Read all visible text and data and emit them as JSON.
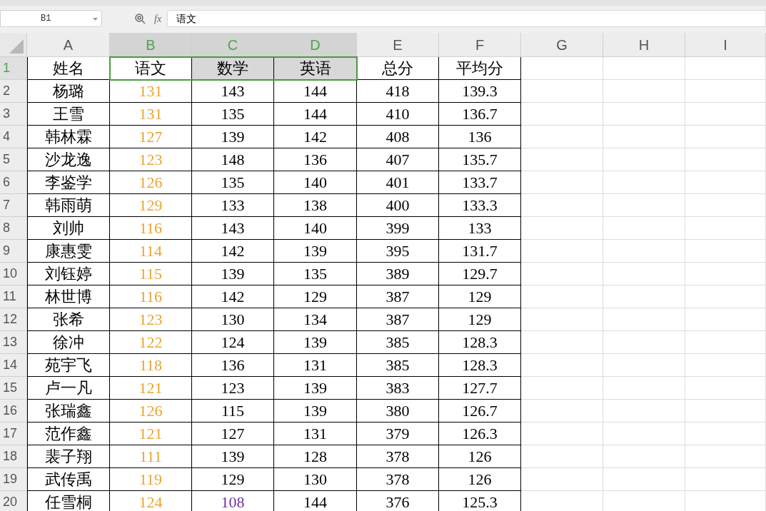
{
  "formula_bar": {
    "name_box": "B1",
    "fx_label": "fx",
    "formula": "语文"
  },
  "columns": [
    {
      "label": "A",
      "selected": false
    },
    {
      "label": "B",
      "selected": true
    },
    {
      "label": "C",
      "selected": true
    },
    {
      "label": "D",
      "selected": true
    },
    {
      "label": "E",
      "selected": false
    },
    {
      "label": "F",
      "selected": false
    },
    {
      "label": "G",
      "selected": false
    },
    {
      "label": "H",
      "selected": false
    },
    {
      "label": "I",
      "selected": false
    }
  ],
  "rows": [
    {
      "number": "1",
      "selected": true,
      "cells": [
        {
          "text": "姓名"
        },
        {
          "text": "语文"
        },
        {
          "text": "数学"
        },
        {
          "text": "英语"
        },
        {
          "text": "总分"
        },
        {
          "text": "平均分"
        }
      ]
    },
    {
      "number": "2",
      "selected": false,
      "cells": [
        {
          "text": "杨璐"
        },
        {
          "text": "131",
          "color": "#eaa42f"
        },
        {
          "text": "143"
        },
        {
          "text": "144"
        },
        {
          "text": "418"
        },
        {
          "text": "139.3"
        }
      ]
    },
    {
      "number": "3",
      "selected": false,
      "cells": [
        {
          "text": "王雪"
        },
        {
          "text": "131",
          "color": "#eaa42f"
        },
        {
          "text": "135"
        },
        {
          "text": "144"
        },
        {
          "text": "410"
        },
        {
          "text": "136.7"
        }
      ]
    },
    {
      "number": "4",
      "selected": false,
      "cells": [
        {
          "text": "韩林霖"
        },
        {
          "text": "127",
          "color": "#eaa42f"
        },
        {
          "text": "139"
        },
        {
          "text": "142"
        },
        {
          "text": "408"
        },
        {
          "text": "136"
        }
      ]
    },
    {
      "number": "5",
      "selected": false,
      "cells": [
        {
          "text": "沙龙逸"
        },
        {
          "text": "123",
          "color": "#eaa42f"
        },
        {
          "text": "148"
        },
        {
          "text": "136"
        },
        {
          "text": "407"
        },
        {
          "text": "135.7"
        }
      ]
    },
    {
      "number": "6",
      "selected": false,
      "cells": [
        {
          "text": "李鉴学"
        },
        {
          "text": "126",
          "color": "#eaa42f"
        },
        {
          "text": "135"
        },
        {
          "text": "140"
        },
        {
          "text": "401"
        },
        {
          "text": "133.7"
        }
      ]
    },
    {
      "number": "7",
      "selected": false,
      "cells": [
        {
          "text": "韩雨萌"
        },
        {
          "text": "129",
          "color": "#eaa42f"
        },
        {
          "text": "133"
        },
        {
          "text": "138"
        },
        {
          "text": "400"
        },
        {
          "text": "133.3"
        }
      ]
    },
    {
      "number": "8",
      "selected": false,
      "cells": [
        {
          "text": "刘帅"
        },
        {
          "text": "116",
          "color": "#eaa42f"
        },
        {
          "text": "143"
        },
        {
          "text": "140"
        },
        {
          "text": "399"
        },
        {
          "text": "133"
        }
      ]
    },
    {
      "number": "9",
      "selected": false,
      "cells": [
        {
          "text": "康惠雯"
        },
        {
          "text": "114",
          "color": "#eaa42f"
        },
        {
          "text": "142"
        },
        {
          "text": "139"
        },
        {
          "text": "395"
        },
        {
          "text": "131.7"
        }
      ]
    },
    {
      "number": "10",
      "selected": false,
      "cells": [
        {
          "text": "刘钰婷"
        },
        {
          "text": "115",
          "color": "#eaa42f"
        },
        {
          "text": "139"
        },
        {
          "text": "135"
        },
        {
          "text": "389"
        },
        {
          "text": "129.7"
        }
      ]
    },
    {
      "number": "11",
      "selected": false,
      "cells": [
        {
          "text": "林世博"
        },
        {
          "text": "116",
          "color": "#eaa42f"
        },
        {
          "text": "142"
        },
        {
          "text": "129"
        },
        {
          "text": "387"
        },
        {
          "text": "129"
        }
      ]
    },
    {
      "number": "12",
      "selected": false,
      "cells": [
        {
          "text": "张希"
        },
        {
          "text": "123",
          "color": "#eaa42f"
        },
        {
          "text": "130"
        },
        {
          "text": "134"
        },
        {
          "text": "387"
        },
        {
          "text": "129"
        }
      ]
    },
    {
      "number": "13",
      "selected": false,
      "cells": [
        {
          "text": "徐冲"
        },
        {
          "text": "122",
          "color": "#eaa42f"
        },
        {
          "text": "124"
        },
        {
          "text": "139"
        },
        {
          "text": "385"
        },
        {
          "text": "128.3"
        }
      ]
    },
    {
      "number": "14",
      "selected": false,
      "cells": [
        {
          "text": "苑宇飞"
        },
        {
          "text": "118",
          "color": "#eaa42f"
        },
        {
          "text": "136"
        },
        {
          "text": "131"
        },
        {
          "text": "385"
        },
        {
          "text": "128.3"
        }
      ]
    },
    {
      "number": "15",
      "selected": false,
      "cells": [
        {
          "text": "卢一凡"
        },
        {
          "text": "121",
          "color": "#eaa42f"
        },
        {
          "text": "123"
        },
        {
          "text": "139"
        },
        {
          "text": "383"
        },
        {
          "text": "127.7"
        }
      ]
    },
    {
      "number": "16",
      "selected": false,
      "cells": [
        {
          "text": "张瑞鑫"
        },
        {
          "text": "126",
          "color": "#eaa42f"
        },
        {
          "text": "115"
        },
        {
          "text": "139"
        },
        {
          "text": "380"
        },
        {
          "text": "126.7"
        }
      ]
    },
    {
      "number": "17",
      "selected": false,
      "cells": [
        {
          "text": "范作鑫"
        },
        {
          "text": "121",
          "color": "#eaa42f"
        },
        {
          "text": "127"
        },
        {
          "text": "131"
        },
        {
          "text": "379"
        },
        {
          "text": "126.3"
        }
      ]
    },
    {
      "number": "18",
      "selected": false,
      "cells": [
        {
          "text": "裴子翔"
        },
        {
          "text": "111",
          "color": "#eaa42f"
        },
        {
          "text": "139"
        },
        {
          "text": "128"
        },
        {
          "text": "378"
        },
        {
          "text": "126"
        }
      ]
    },
    {
      "number": "19",
      "selected": false,
      "cells": [
        {
          "text": "武传禹"
        },
        {
          "text": "119",
          "color": "#eaa42f"
        },
        {
          "text": "129"
        },
        {
          "text": "130"
        },
        {
          "text": "378"
        },
        {
          "text": "126"
        }
      ]
    },
    {
      "number": "20",
      "selected": false,
      "cells": [
        {
          "text": "任雪桐"
        },
        {
          "text": "124",
          "color": "#eaa42f"
        },
        {
          "text": "108",
          "color": "#7030a0"
        },
        {
          "text": "144"
        },
        {
          "text": "376"
        },
        {
          "text": "125.3"
        }
      ]
    }
  ]
}
